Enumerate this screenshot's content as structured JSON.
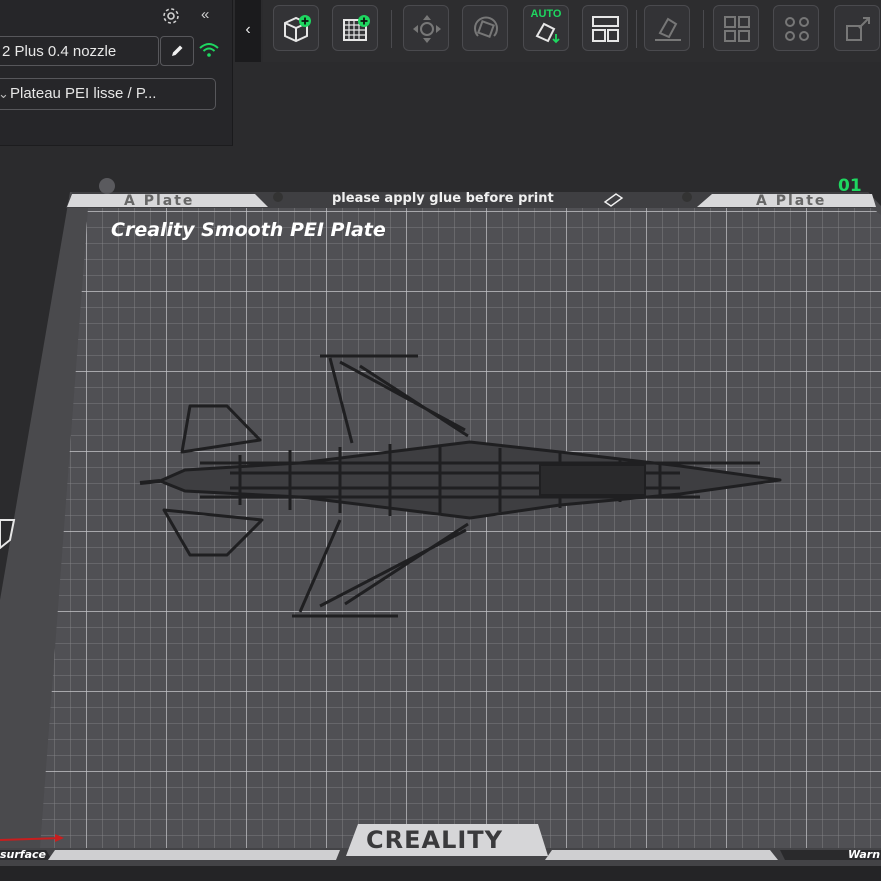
{
  "sidebar": {
    "printer_name": "2 Plus 0.4 nozzle",
    "plate_type": "Plateau PEI lisse / P...",
    "icons": [
      "gear-icon",
      "double-chevron-left-icon",
      "pencil-icon",
      "wifi-icon",
      "chevron-down-icon"
    ]
  },
  "toolbar": {
    "collapse_glyph": "‹",
    "auto_label": "AUTO",
    "buttons": [
      "add-object-icon",
      "add-plate-icon",
      "move-icon",
      "rotate-icon",
      "auto-orient-icon",
      "arrange-icon",
      "lay-on-face-icon",
      "split-objects-icon",
      "split-parts-icon",
      "scale-icon"
    ]
  },
  "plate": {
    "left_label": "A Plate",
    "right_label": "A Plate",
    "glue_note": "please apply glue before print",
    "title": "Creality Smooth PEI Plate",
    "plate_number": "01",
    "brand": "CREALITY",
    "surface_label": "surface",
    "warn_label": "Warn",
    "accent_color": "#1ed760"
  }
}
